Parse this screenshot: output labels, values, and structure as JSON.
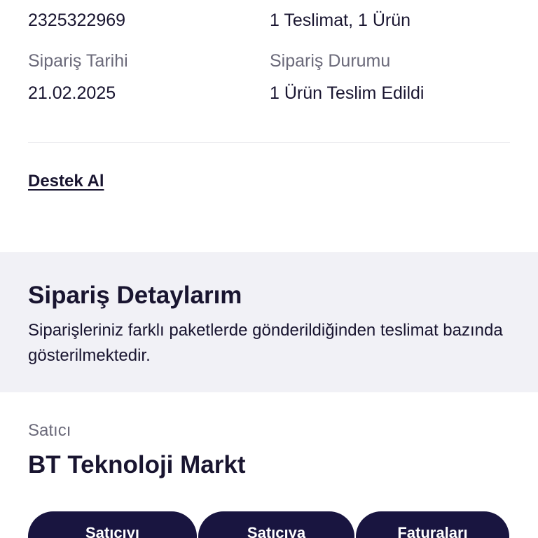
{
  "order_info": {
    "order_number_value": "2325322969",
    "delivery_summary_value": "1 Teslimat, 1 Ürün",
    "order_date_label": "Sipariş Tarihi",
    "order_date_value": "21.02.2025",
    "order_status_label": "Sipariş Durumu",
    "order_status_value": "1 Ürün Teslim Edildi"
  },
  "support": {
    "link_label": "Destek Al"
  },
  "order_details": {
    "title": "Sipariş Detaylarım",
    "description": "Siparişleriniz farklı paketlerde gönderildiğinden teslimat bazında gösterilmektedir."
  },
  "seller": {
    "label": "Satıcı",
    "name": "BT Teknoloji Markt"
  },
  "actions": {
    "button_1": "Satıcıyı",
    "button_2": "Satıcıya",
    "button_3": "Faturaları"
  },
  "colors": {
    "primary_dark": "#191540",
    "band_bg": "#f1f1f6",
    "muted_text": "#6b6a7a"
  }
}
